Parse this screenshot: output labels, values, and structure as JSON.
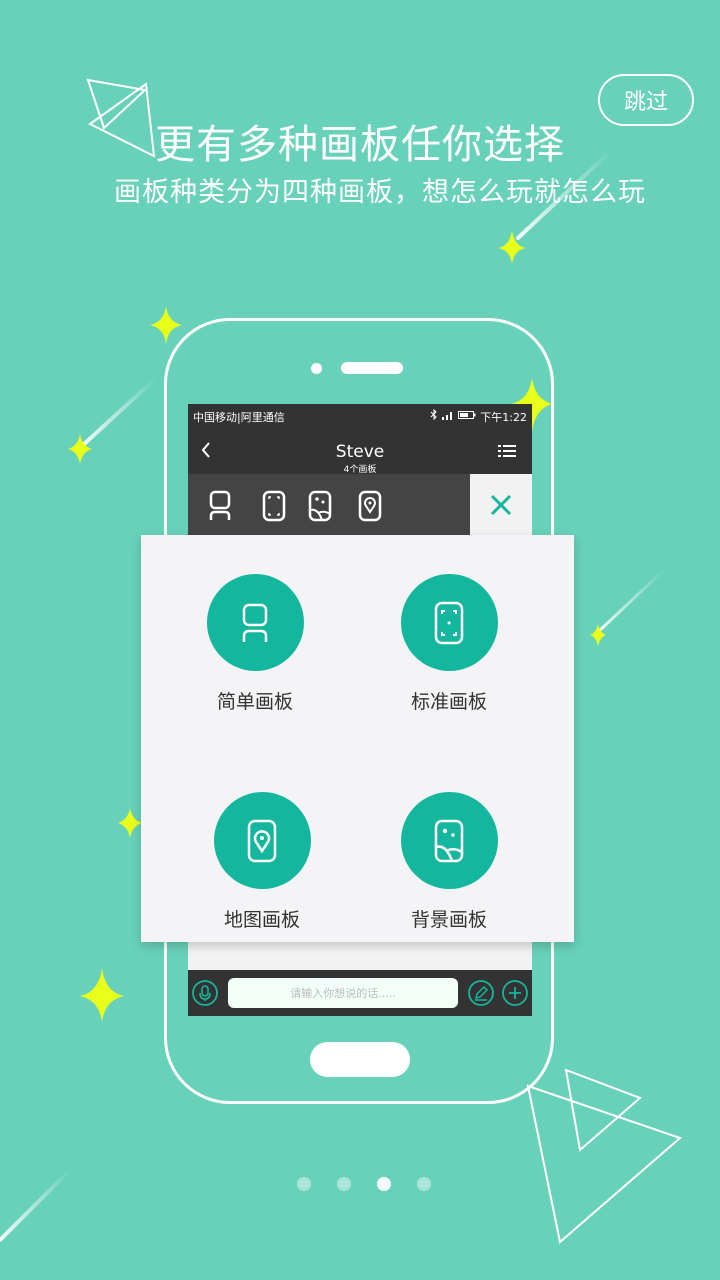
{
  "skip_label": "跳过",
  "headline": "更有多种画板任你选择",
  "subline": "画板种类分为四种画板，想怎么玩就怎么玩",
  "phone_screen": {
    "status": {
      "carrier": "中国移动|阿里通信",
      "time": "下午1:22"
    },
    "nav": {
      "title": "Steve",
      "subtitle": "4个画板"
    },
    "input_placeholder": "请输入你想说的话....."
  },
  "board_options": [
    {
      "label": "简单画板",
      "icon": "person-board-icon"
    },
    {
      "label": "标准画板",
      "icon": "frame-board-icon"
    },
    {
      "label": "地图画板",
      "icon": "map-pin-board-icon"
    },
    {
      "label": "背景画板",
      "icon": "landscape-board-icon"
    }
  ],
  "pager": {
    "total": 4,
    "active_index": 2
  },
  "colors": {
    "background": "#68d1b9",
    "accent": "#14b79d",
    "sparkle": "#e8ff1a",
    "dark": "#333333"
  }
}
